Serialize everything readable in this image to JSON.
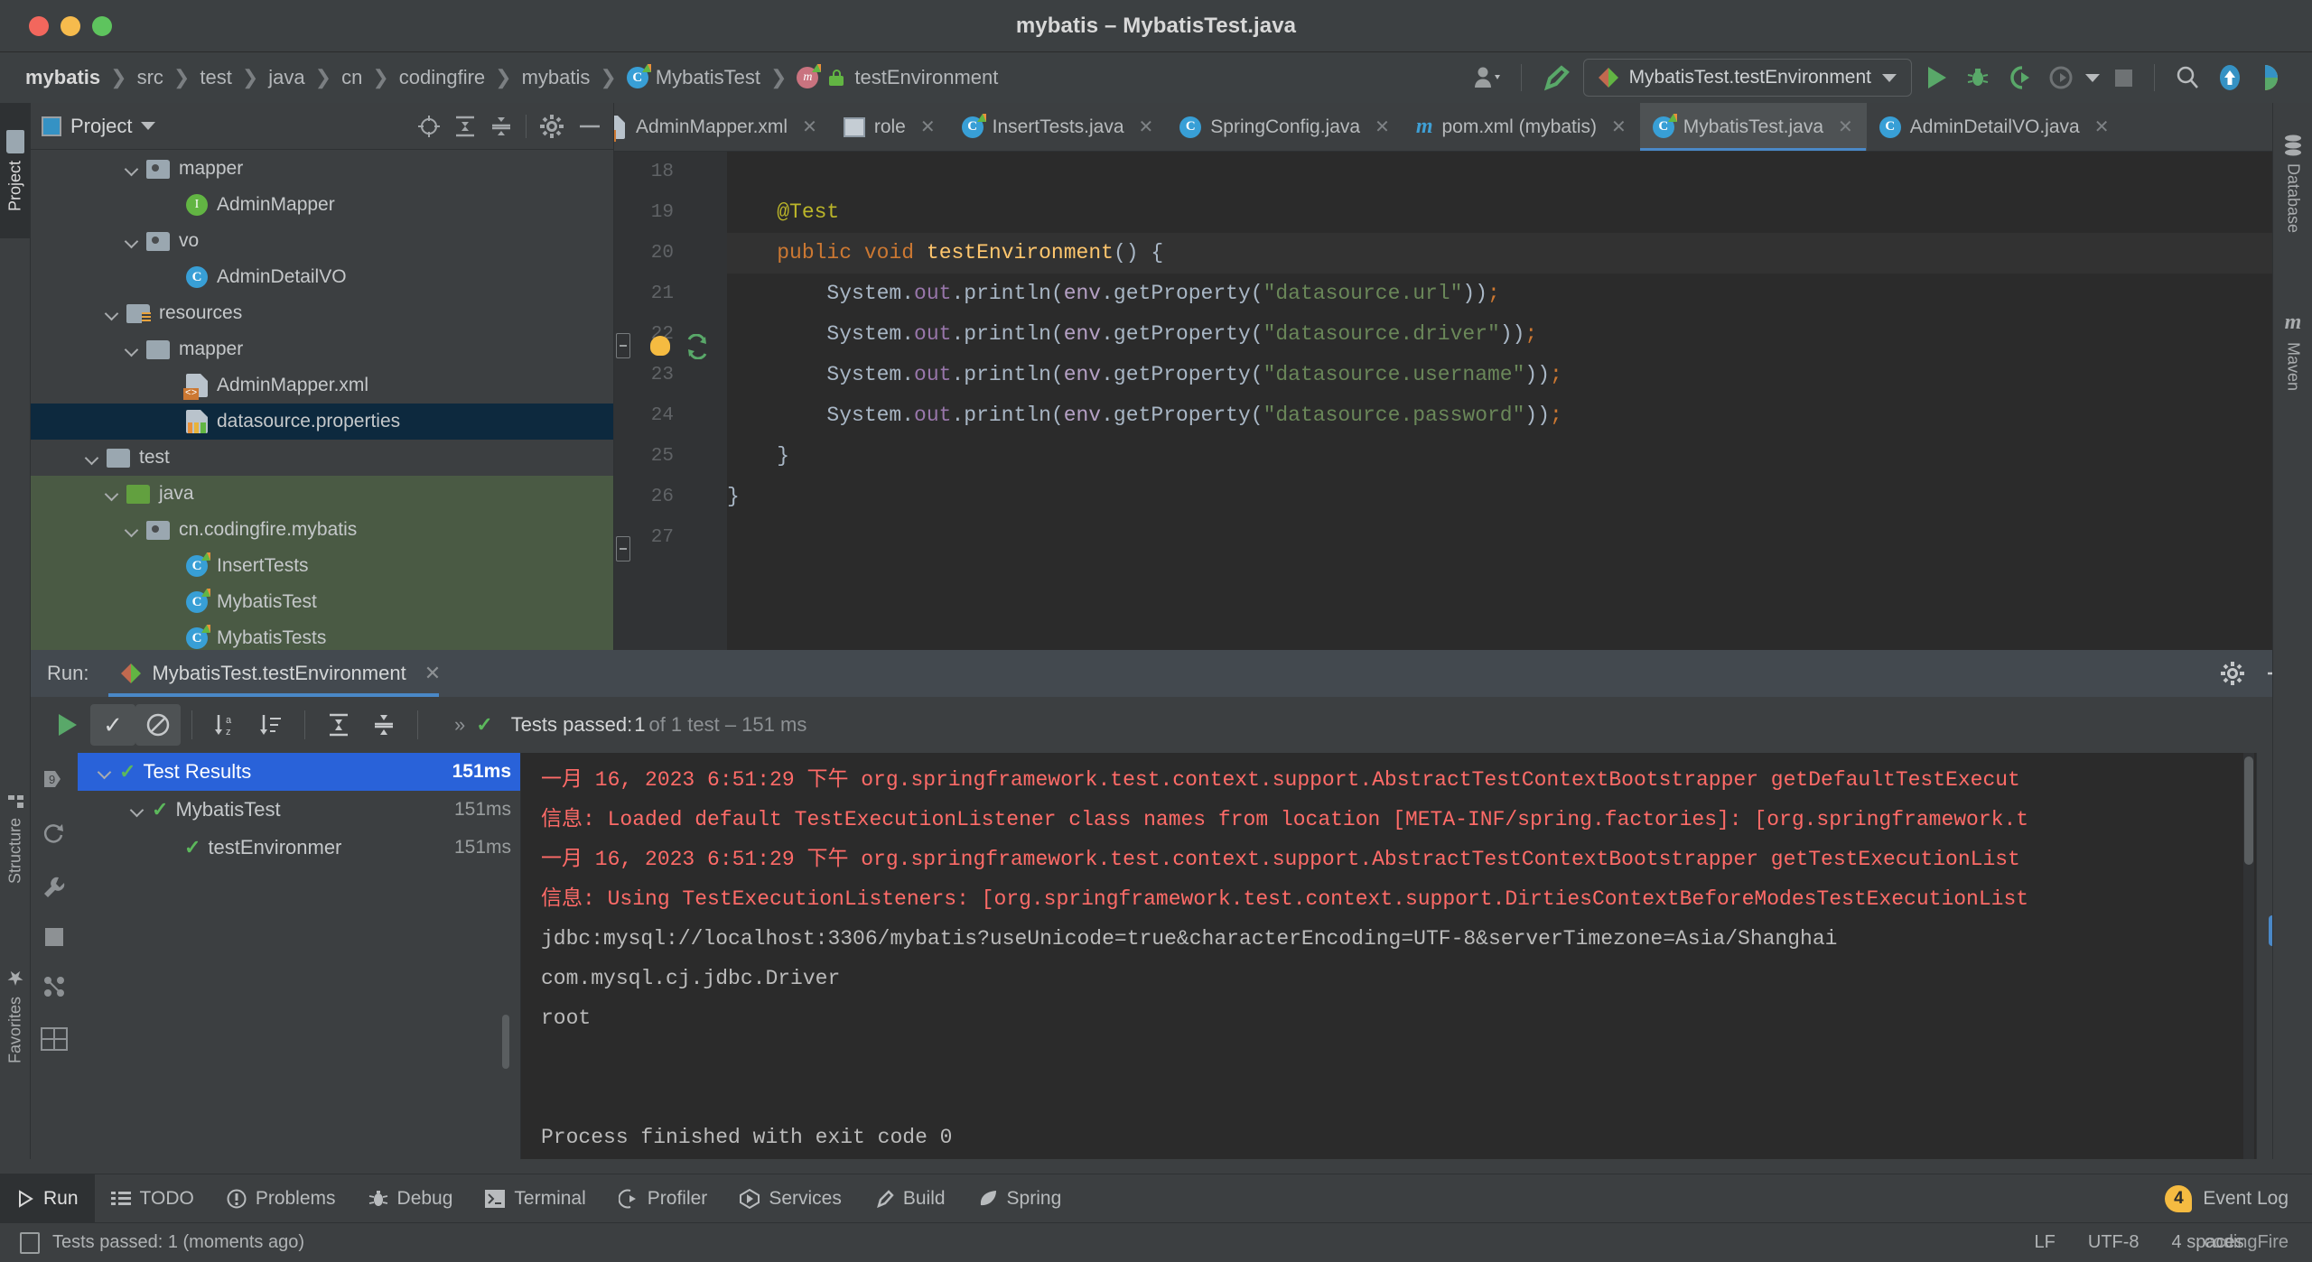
{
  "window": {
    "title": "mybatis – MybatisTest.java",
    "traffic_lights": [
      "close",
      "minimize",
      "maximize"
    ]
  },
  "breadcrumb": {
    "items": [
      {
        "label": "mybatis",
        "icon": "none",
        "root": true
      },
      {
        "label": "src",
        "icon": "none"
      },
      {
        "label": "test",
        "icon": "none"
      },
      {
        "label": "java",
        "icon": "none"
      },
      {
        "label": "cn",
        "icon": "none"
      },
      {
        "label": "codingfire",
        "icon": "none"
      },
      {
        "label": "mybatis",
        "icon": "none"
      },
      {
        "label": "MybatisTest",
        "icon": "class-icon"
      },
      {
        "label": "testEnvironment",
        "icon": "method-icon"
      }
    ]
  },
  "toolbar": {
    "user_icon": "user-icon",
    "build_icon": "build-hammer-icon",
    "run_config": "MybatisTest.testEnvironment",
    "run_icon": "run-play-icon",
    "debug_icon": "debug-bug-icon",
    "run_coverage_icon": "run-with-coverage-icon",
    "profile_icon": "profile-icon",
    "stop_icon": "stop-icon",
    "search_icon": "search-everywhere-icon",
    "update_icon": "update-project-icon",
    "settings_icon": "ide-assistant-icon"
  },
  "editor_tabs": [
    {
      "label": "AdminMapper.xml",
      "icon": "xml-file-icon",
      "active": false
    },
    {
      "label": "role",
      "icon": "database-table-icon",
      "active": false
    },
    {
      "label": "InsertTests.java",
      "icon": "test-class-icon",
      "active": false
    },
    {
      "label": "SpringConfig.java",
      "icon": "class-icon",
      "active": false
    },
    {
      "label": "pom.xml (mybatis)",
      "icon": "maven-icon",
      "active": false
    },
    {
      "label": "MybatisTest.java",
      "icon": "test-class-icon",
      "active": true
    },
    {
      "label": "AdminDetailVO.java",
      "icon": "class-icon",
      "active": false
    }
  ],
  "project_panel": {
    "title": "Project",
    "actions": [
      "locate-icon",
      "expand-all-icon",
      "collapse-all-icon",
      "settings-gear-icon",
      "hide-icon"
    ],
    "tree": [
      {
        "label": "mapper",
        "icon": "package-folder-icon",
        "indent": 4,
        "expanded": true,
        "bg": "none"
      },
      {
        "label": "AdminMapper",
        "icon": "interface-icon",
        "indent": 6,
        "expanded": null,
        "bg": "none"
      },
      {
        "label": "vo",
        "icon": "package-folder-icon",
        "indent": 4,
        "expanded": true,
        "bg": "none"
      },
      {
        "label": "AdminDetailVO",
        "icon": "class-icon",
        "indent": 6,
        "expanded": null,
        "bg": "none"
      },
      {
        "label": "resources",
        "icon": "resources-folder-icon",
        "indent": 3,
        "expanded": true,
        "bg": "none"
      },
      {
        "label": "mapper",
        "icon": "folder-icon",
        "indent": 4,
        "expanded": true,
        "bg": "none"
      },
      {
        "label": "AdminMapper.xml",
        "icon": "xml-file-icon",
        "indent": 6,
        "expanded": null,
        "bg": "none"
      },
      {
        "label": "datasource.properties",
        "icon": "properties-file-icon",
        "indent": 6,
        "expanded": null,
        "bg": "selected"
      },
      {
        "label": "test",
        "icon": "folder-icon",
        "indent": 2,
        "expanded": true,
        "bg": "none"
      },
      {
        "label": "java",
        "icon": "test-source-folder-icon",
        "indent": 3,
        "expanded": true,
        "bg": "green"
      },
      {
        "label": "cn.codingfire.mybatis",
        "icon": "package-folder-icon",
        "indent": 4,
        "expanded": true,
        "bg": "green"
      },
      {
        "label": "InsertTests",
        "icon": "test-class-icon",
        "indent": 6,
        "expanded": null,
        "bg": "green"
      },
      {
        "label": "MybatisTest",
        "icon": "test-class-icon",
        "indent": 6,
        "expanded": null,
        "bg": "green"
      },
      {
        "label": "MybatisTests",
        "icon": "test-class-icon",
        "indent": 6,
        "expanded": null,
        "bg": "green"
      }
    ]
  },
  "left_strip": {
    "tabs": [
      "Project",
      "Structure",
      "Favorites"
    ]
  },
  "right_strip": {
    "tabs": [
      "Database",
      "Maven"
    ]
  },
  "code": {
    "first_line_number": 18,
    "lines": [
      {
        "num": 18,
        "tokens": []
      },
      {
        "num": 19,
        "tokens": [
          {
            "t": "    ",
            "c": "pun"
          },
          {
            "t": "@Test",
            "c": "ann"
          }
        ]
      },
      {
        "num": 20,
        "tokens": [
          {
            "t": "    ",
            "c": "pun"
          },
          {
            "t": "public",
            "c": "kw"
          },
          {
            "t": " ",
            "c": "pun"
          },
          {
            "t": "void",
            "c": "kw"
          },
          {
            "t": " ",
            "c": "pun"
          },
          {
            "t": "testEnvironment",
            "c": "mth"
          },
          {
            "t": "() {",
            "c": "pun"
          }
        ],
        "highlight": true,
        "gutter": "run-test-icon",
        "bulb": true,
        "fold": true
      },
      {
        "num": 21,
        "tokens": [
          {
            "t": "        System.",
            "c": "pun"
          },
          {
            "t": "out",
            "c": "fld"
          },
          {
            "t": ".println(",
            "c": "pun"
          },
          {
            "t": "env",
            "c": "prm"
          },
          {
            "t": ".getProperty(",
            "c": "pun"
          },
          {
            "t": "\"datasource.url\"",
            "c": "str"
          },
          {
            "t": "))",
            "c": "pun"
          },
          {
            "t": ";",
            "c": "semi"
          }
        ]
      },
      {
        "num": 22,
        "tokens": [
          {
            "t": "        System.",
            "c": "pun"
          },
          {
            "t": "out",
            "c": "fld"
          },
          {
            "t": ".println(",
            "c": "pun"
          },
          {
            "t": "env",
            "c": "prm"
          },
          {
            "t": ".getProperty(",
            "c": "pun"
          },
          {
            "t": "\"datasource.driver\"",
            "c": "str"
          },
          {
            "t": "))",
            "c": "pun"
          },
          {
            "t": ";",
            "c": "semi"
          }
        ]
      },
      {
        "num": 23,
        "tokens": [
          {
            "t": "        System.",
            "c": "pun"
          },
          {
            "t": "out",
            "c": "fld"
          },
          {
            "t": ".println(",
            "c": "pun"
          },
          {
            "t": "env",
            "c": "prm"
          },
          {
            "t": ".getProperty(",
            "c": "pun"
          },
          {
            "t": "\"datasource.username\"",
            "c": "str"
          },
          {
            "t": "))",
            "c": "pun"
          },
          {
            "t": ";",
            "c": "semi"
          }
        ]
      },
      {
        "num": 24,
        "tokens": [
          {
            "t": "        System.",
            "c": "pun"
          },
          {
            "t": "out",
            "c": "fld"
          },
          {
            "t": ".println(",
            "c": "pun"
          },
          {
            "t": "env",
            "c": "prm"
          },
          {
            "t": ".getProperty(",
            "c": "pun"
          },
          {
            "t": "\"datasource.password\"",
            "c": "str"
          },
          {
            "t": "))",
            "c": "pun"
          },
          {
            "t": ";",
            "c": "semi"
          }
        ]
      },
      {
        "num": 25,
        "tokens": [
          {
            "t": "    }",
            "c": "pun"
          }
        ],
        "fold": true
      },
      {
        "num": 26,
        "tokens": [
          {
            "t": "}",
            "c": "pun"
          }
        ]
      },
      {
        "num": 27,
        "tokens": []
      }
    ]
  },
  "run_panel": {
    "label": "Run:",
    "tab_title": "MybatisTest.testEnvironment",
    "tab_icon": "junit-diamond-icon",
    "close_icon": "close-icon",
    "header_actions": [
      "settings-gear-icon",
      "hide-panel-icon"
    ],
    "toolbar": {
      "rerun_icon": "rerun-play-icon",
      "show_passed_icon": "show-passed-checkmark-icon",
      "show_ignored_icon": "show-ignored-icon",
      "sort_alpha_icon": "sort-alphabetically-icon",
      "sort_duration_icon": "sort-by-duration-icon",
      "expand_all_icon": "expand-all-icon",
      "collapse_all_icon": "collapse-all-icon",
      "overflow_icon": "overflow-chevrons-icon"
    },
    "status": {
      "icon": "green-check-icon",
      "passed_text": "Tests passed: ",
      "passed_count": "1",
      "of_text": " of 1 test – 151 ms"
    },
    "side_icons": [
      "breakpoints-icon",
      "restart-icon",
      "wrench-icon",
      "stop-square-icon",
      "threads-icon",
      "layout-icon"
    ],
    "test_tree": [
      {
        "label": "Test Results",
        "time": "151ms",
        "indent": 0,
        "expanded": true,
        "selected": true
      },
      {
        "label": "MybatisTest",
        "time": "151ms",
        "indent": 1,
        "expanded": true,
        "selected": false
      },
      {
        "label": "testEnvironmer",
        "time": "151ms",
        "indent": 2,
        "expanded": null,
        "selected": false
      }
    ],
    "console_lines": [
      {
        "text": "一月 16, 2023 6:51:29 下午 org.springframework.test.context.support.AbstractTestContextBootstrapper getDefaultTestExecut",
        "type": "err"
      },
      {
        "text": "信息: Loaded default TestExecutionListener class names from location [META-INF/spring.factories]: [org.springframework.t",
        "type": "err"
      },
      {
        "text": "一月 16, 2023 6:51:29 下午 org.springframework.test.context.support.AbstractTestContextBootstrapper getTestExecutionList",
        "type": "err"
      },
      {
        "text": "信息: Using TestExecutionListeners: [org.springframework.test.context.support.DirtiesContextBeforeModesTestExecutionList",
        "type": "err"
      },
      {
        "text": "jdbc:mysql://localhost:3306/mybatis?useUnicode=true&characterEncoding=UTF-8&serverTimezone=Asia/Shanghai",
        "type": "out"
      },
      {
        "text": "com.mysql.cj.jdbc.Driver",
        "type": "out"
      },
      {
        "text": "root",
        "type": "out"
      },
      {
        "text": "",
        "type": "out"
      },
      {
        "text": "",
        "type": "out"
      },
      {
        "text": "Process finished with exit code 0",
        "type": "out"
      }
    ],
    "console_rail_icons": [
      "scroll-up-icon",
      "scroll-down-icon",
      "soft-wrap-icon",
      "scroll-to-end-icon",
      "print-icon",
      "clear-all-icon"
    ]
  },
  "bottom_bar": {
    "items": [
      {
        "label": "Run",
        "icon": "run-play-icon",
        "active": true
      },
      {
        "label": "TODO",
        "icon": "todo-list-icon",
        "active": false
      },
      {
        "label": "Problems",
        "icon": "problems-icon",
        "active": false
      },
      {
        "label": "Debug",
        "icon": "debug-bug-icon",
        "active": false
      },
      {
        "label": "Terminal",
        "icon": "terminal-icon",
        "active": false
      },
      {
        "label": "Profiler",
        "icon": "profiler-icon",
        "active": false
      },
      {
        "label": "Services",
        "icon": "services-icon",
        "active": false
      },
      {
        "label": "Build",
        "icon": "build-hammer-icon",
        "active": false
      },
      {
        "label": "Spring",
        "icon": "spring-leaf-icon",
        "active": false
      }
    ],
    "event_log": {
      "label": "Event Log",
      "badge": "4"
    }
  },
  "status_bar": {
    "icon": "memory-indicator-icon",
    "message": "Tests passed: 1 (moments ago)",
    "line_separator": "LF",
    "encoding": "UTF-8",
    "indent": "4 spaces",
    "branch": "codingFire"
  },
  "colors": {
    "accent_blue": "#4a88c7",
    "selection_blue": "#2962d9",
    "tree_selection": "#0d293e",
    "test_green": "#62b543",
    "error_red": "#ff6b68",
    "string_green": "#6a8759",
    "keyword_orange": "#cc7832",
    "method_yellow": "#ffc66d",
    "field_purple": "#9876aa",
    "annotation_olive": "#bbb529",
    "panel_bg": "#3c3f41",
    "editor_bg": "#2b2b2b",
    "badge_amber": "#f5bb41"
  }
}
